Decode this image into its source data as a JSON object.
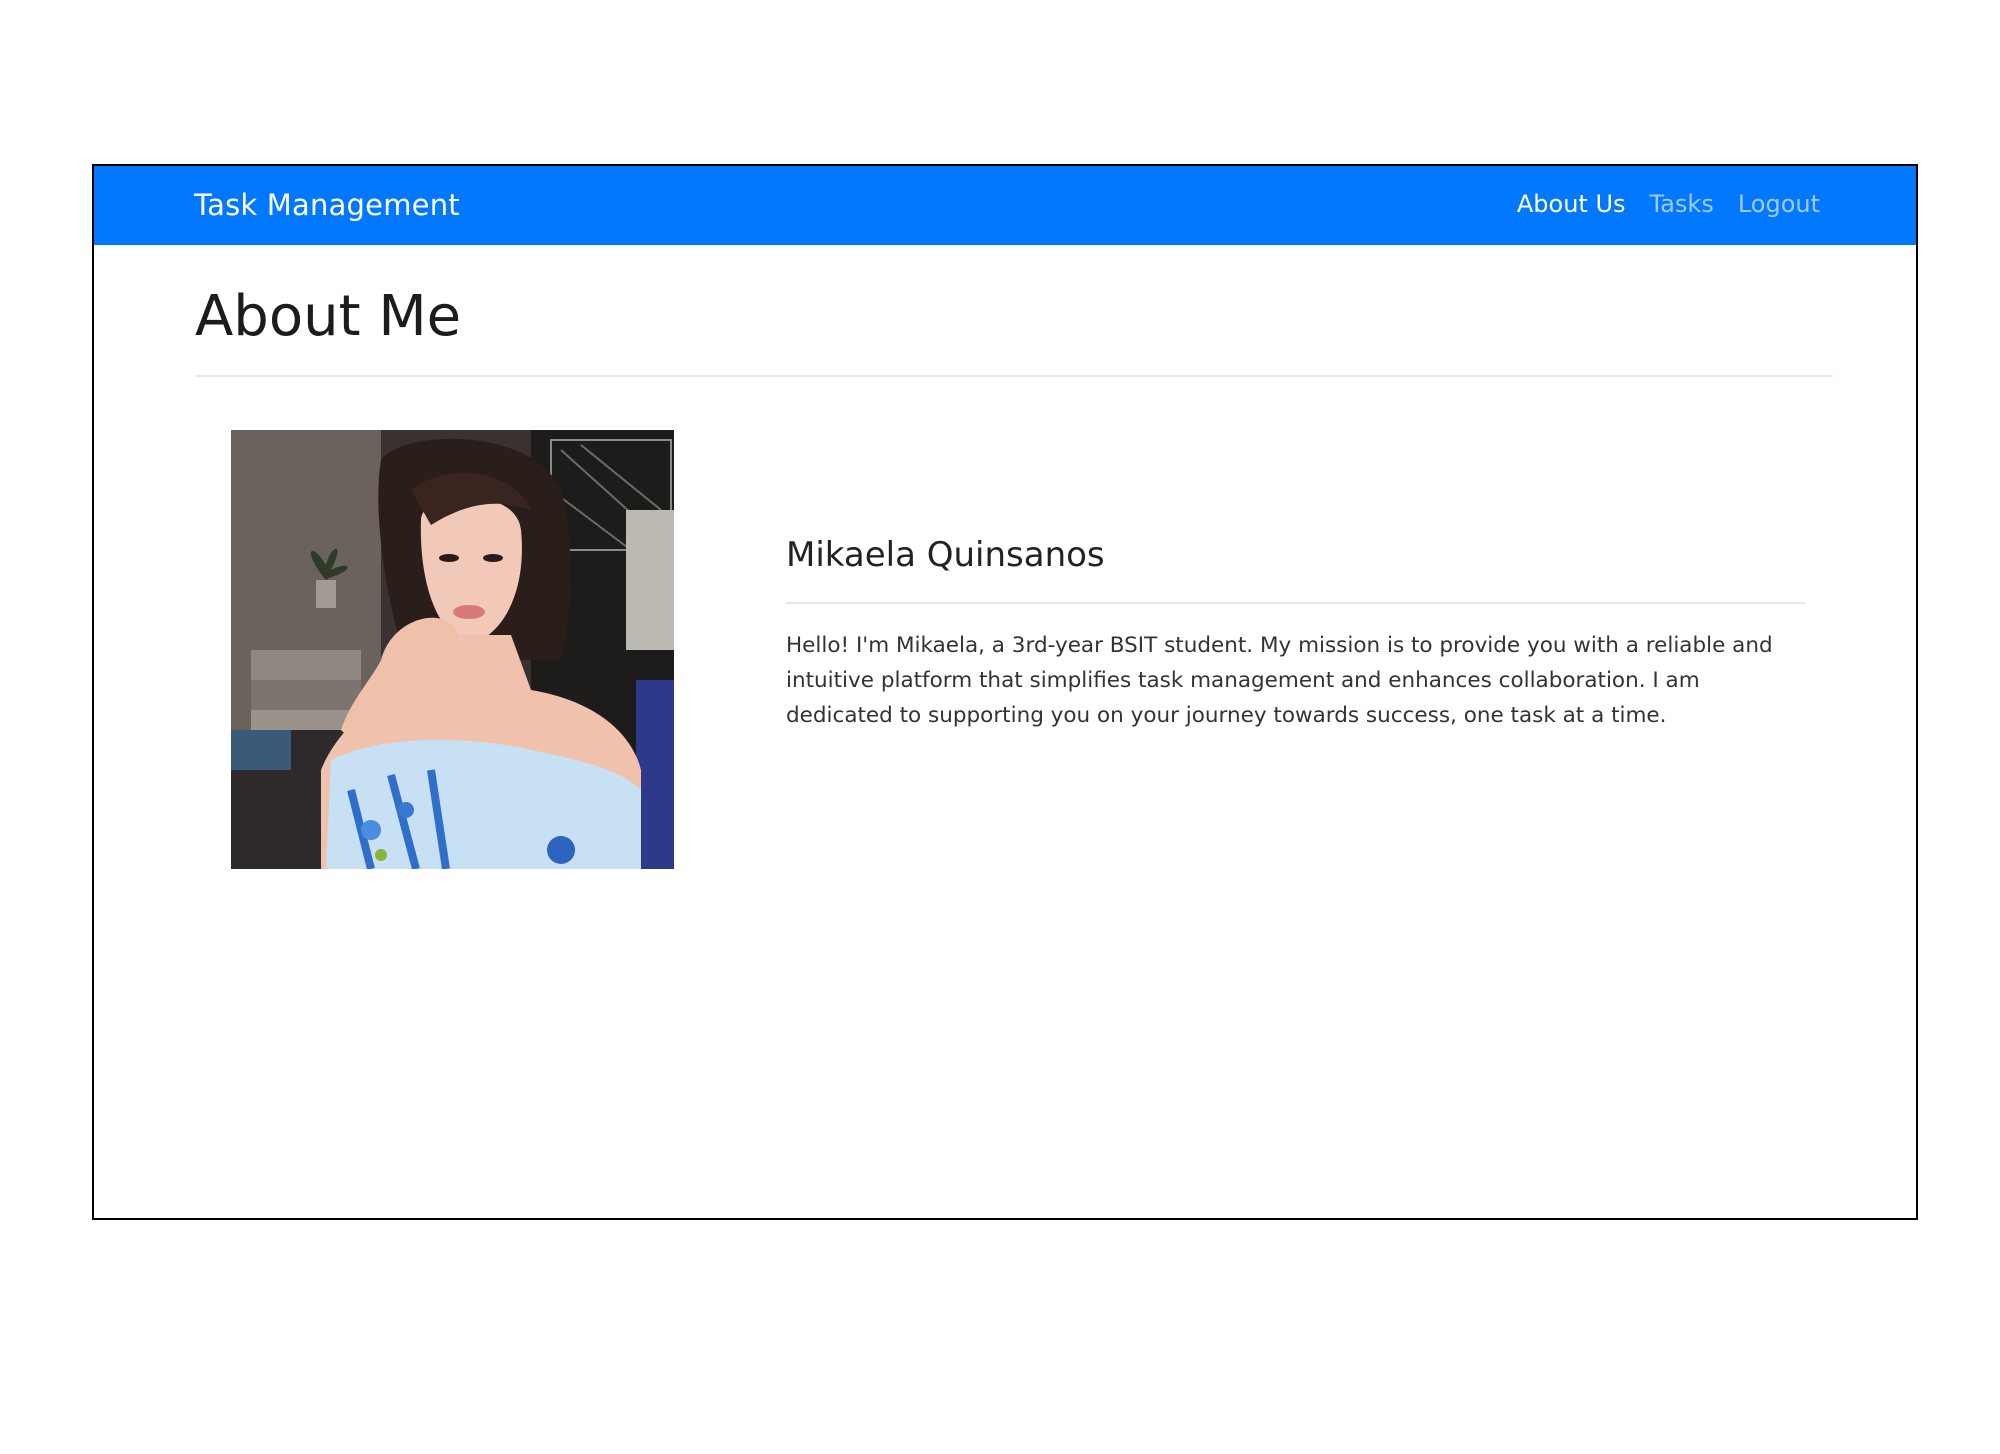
{
  "navbar": {
    "brand": "Task Management",
    "links": [
      {
        "label": "About Us",
        "active": true
      },
      {
        "label": "Tasks",
        "active": false
      },
      {
        "label": "Logout",
        "active": false
      }
    ]
  },
  "main": {
    "title": "About Me",
    "profile": {
      "name": "Mikaela Quinsanos",
      "bio": "Hello! I'm Mikaela, a 3rd-year BSIT student. My mission is to provide you with a reliable and intuitive platform that simplifies task management and enhances collaboration. I am dedicated to supporting you on your journey towards success, one task at a time."
    }
  },
  "colors": {
    "navbar_bg": "#0278fe",
    "nav_link_active": "#ffffff",
    "nav_link_inactive": "rgba(255,255,255,0.62)",
    "page_bg": "#ffffff",
    "frame_border": "#000000"
  }
}
